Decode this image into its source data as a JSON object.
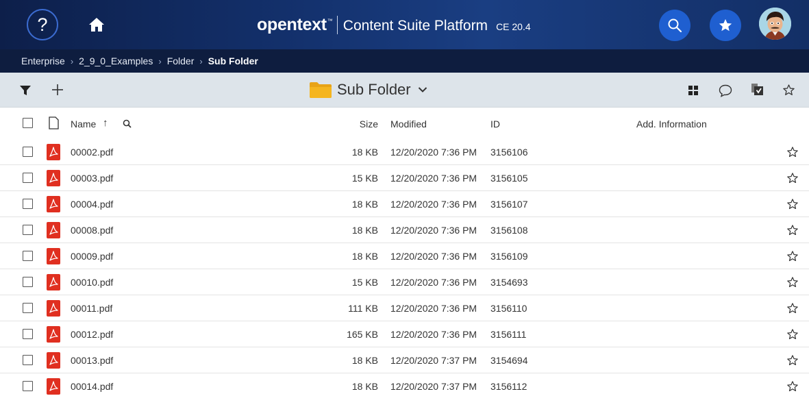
{
  "header": {
    "help_label": "?",
    "brand_logo": "opentext",
    "brand_tm": "™",
    "product": "Content Suite Platform",
    "version": "CE 20.4",
    "accent": "#1f5fd0"
  },
  "breadcrumb": {
    "items": [
      "Enterprise",
      "2_9_0_Examples",
      "Folder",
      "Sub Folder"
    ]
  },
  "toolbar": {
    "folder_name": "Sub Folder",
    "icons": [
      "filter-icon",
      "add-icon",
      "folder-icon",
      "chevron-down-icon",
      "grid-view-icon",
      "comment-icon",
      "collect-icon",
      "favorite-icon"
    ]
  },
  "table": {
    "columns": {
      "name": "Name",
      "size": "Size",
      "modified": "Modified",
      "id": "ID",
      "add_info": "Add. Information"
    },
    "sort_indicator": "↑",
    "rows": [
      {
        "name": "00002.pdf",
        "size": "18 KB",
        "modified": "12/20/2020 7:36 PM",
        "id": "3156106"
      },
      {
        "name": "00003.pdf",
        "size": "15 KB",
        "modified": "12/20/2020 7:36 PM",
        "id": "3156105"
      },
      {
        "name": "00004.pdf",
        "size": "18 KB",
        "modified": "12/20/2020 7:36 PM",
        "id": "3156107"
      },
      {
        "name": "00008.pdf",
        "size": "18 KB",
        "modified": "12/20/2020 7:36 PM",
        "id": "3156108"
      },
      {
        "name": "00009.pdf",
        "size": "18 KB",
        "modified": "12/20/2020 7:36 PM",
        "id": "3156109"
      },
      {
        "name": "00010.pdf",
        "size": "15 KB",
        "modified": "12/20/2020 7:36 PM",
        "id": "3154693"
      },
      {
        "name": "00011.pdf",
        "size": "111 KB",
        "modified": "12/20/2020 7:36 PM",
        "id": "3156110"
      },
      {
        "name": "00012.pdf",
        "size": "165 KB",
        "modified": "12/20/2020 7:36 PM",
        "id": "3156111"
      },
      {
        "name": "00013.pdf",
        "size": "18 KB",
        "modified": "12/20/2020 7:37 PM",
        "id": "3154694"
      },
      {
        "name": "00014.pdf",
        "size": "18 KB",
        "modified": "12/20/2020 7:37 PM",
        "id": "3156112"
      }
    ]
  }
}
